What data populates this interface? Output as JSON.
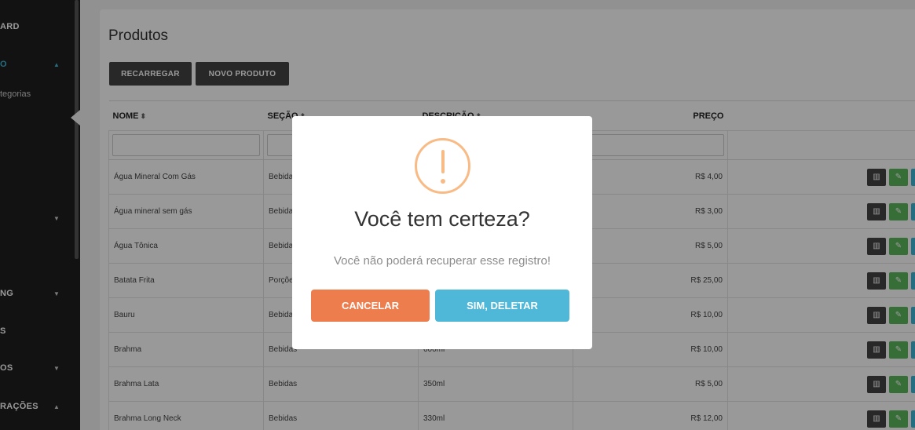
{
  "sidebar": {
    "items": [
      {
        "label": "ARD"
      },
      {
        "label": "O"
      },
      {
        "label": "tegorias"
      },
      {
        "label": "NG"
      },
      {
        "label": "S"
      },
      {
        "label": "OS"
      },
      {
        "label": "RAÇÕES"
      }
    ]
  },
  "page": {
    "title": "Produtos",
    "reload_label": "RECARREGAR",
    "new_label": "NOVO PRODUTO"
  },
  "table": {
    "headers": [
      "NOME",
      "SEÇÃO",
      "DESCRIÇÃO",
      "PREÇO"
    ],
    "rows": [
      {
        "nome": "Água Mineral Com Gás",
        "secao": "Bebidas",
        "descricao": "",
        "preco": "R$ 4,00"
      },
      {
        "nome": "Água mineral sem gás",
        "secao": "Bebidas",
        "descricao": "",
        "preco": "R$ 3,00"
      },
      {
        "nome": "Água Tônica",
        "secao": "Bebidas",
        "descricao": "",
        "preco": "R$ 5,00"
      },
      {
        "nome": "Batata Frita",
        "secao": "Porções",
        "descricao": "",
        "preco": "R$ 25,00"
      },
      {
        "nome": "Bauru",
        "secao": "Bebidas",
        "descricao": "",
        "preco": "R$ 10,00"
      },
      {
        "nome": "Brahma",
        "secao": "Bebidas",
        "descricao": "600ml",
        "preco": "R$ 10,00"
      },
      {
        "nome": "Brahma Lata",
        "secao": "Bebidas",
        "descricao": "350ml",
        "preco": "R$ 5,00"
      },
      {
        "nome": "Brahma Long Neck",
        "secao": "Bebidas",
        "descricao": "330ml",
        "preco": "R$ 12,00"
      }
    ]
  },
  "modal": {
    "icon": "warning-icon",
    "title": "Você tem certeza?",
    "text": "Você não poderá recuperar esse registro!",
    "cancel_label": "CANCELAR",
    "confirm_label": "SIM, DELETAR",
    "accent": "#f8bb86",
    "cancel_color": "#ed7d4d",
    "confirm_color": "#4fb8d8"
  }
}
